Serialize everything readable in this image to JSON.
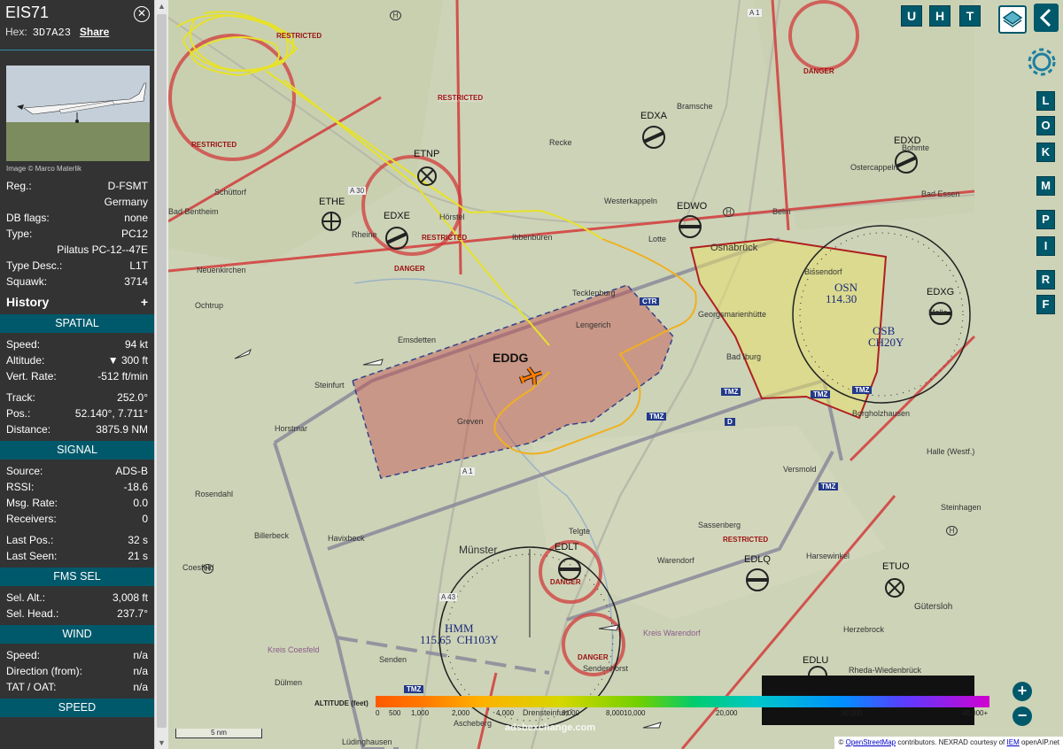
{
  "aircraft": {
    "callsign": "EIS71",
    "hex_label": "Hex:",
    "hex": "3D7A23",
    "share": "Share",
    "photo_credit": "Image © Marco Materlik"
  },
  "info_rows": [
    {
      "key": "Reg.:",
      "value": "D-FSMT"
    },
    {
      "key": "",
      "value": "Germany"
    },
    {
      "key": "DB flags:",
      "value": "none"
    },
    {
      "key": "Type:",
      "value": "PC12"
    },
    {
      "key": "",
      "value": "Pilatus PC-12--47E"
    },
    {
      "key": "Type Desc.:",
      "value": "L1T"
    },
    {
      "key": "Squawk:",
      "value": "3714"
    }
  ],
  "history_label": "History",
  "history_plus": "+",
  "sections": {
    "spatial": "SPATIAL",
    "signal": "SIGNAL",
    "fms": "FMS SEL",
    "wind": "WIND",
    "speed": "SPEED"
  },
  "spatial_rows": [
    {
      "key": "Speed:",
      "value": "94 kt"
    },
    {
      "key": "Altitude:",
      "value": "▼ 300 ft"
    },
    {
      "key": "Vert. Rate:",
      "value": "-512 ft/min"
    },
    {
      "key": "Track:",
      "value": "252.0°"
    },
    {
      "key": "Pos.:",
      "value": "52.140°, 7.711°"
    },
    {
      "key": "Distance:",
      "value": "3875.9 NM"
    }
  ],
  "signal_rows": [
    {
      "key": "Source:",
      "value": "ADS-B"
    },
    {
      "key": "RSSI:",
      "value": "-18.6"
    },
    {
      "key": "Msg. Rate:",
      "value": "0.0"
    },
    {
      "key": "Receivers:",
      "value": "0"
    },
    {
      "key": "Last Pos.:",
      "value": "32 s"
    },
    {
      "key": "Last Seen:",
      "value": "21 s"
    }
  ],
  "fms_rows": [
    {
      "key": "Sel. Alt.:",
      "value": "3,008 ft"
    },
    {
      "key": "Sel. Head.:",
      "value": "237.7°"
    }
  ],
  "wind_rows": [
    {
      "key": "Speed:",
      "value": "n/a"
    },
    {
      "key": "Direction (from):",
      "value": "n/a"
    },
    {
      "key": "TAT / OAT:",
      "value": "n/a"
    }
  ],
  "top_buttons": [
    "U",
    "H",
    "T"
  ],
  "side_buttons": [
    "L",
    "O",
    "K",
    "M",
    "P",
    "I",
    "R",
    "F"
  ],
  "map": {
    "labels": {
      "restricted": "RESTRICTED",
      "danger": "DANGER",
      "ctr": "CTR",
      "tmz": "TMZ",
      "d": "D",
      "eddg": "EDDG",
      "etnp": "ETNP",
      "ethe": "ETHE",
      "edxe": "EDXE",
      "edxa": "EDXA",
      "edwo": "EDWO",
      "edxd": "EDXD",
      "edxg": "EDXG",
      "edlt": "EDLT",
      "edlq": "EDLQ",
      "etuo": "ETUO",
      "edlu": "EDLU",
      "osn": "OSN",
      "osn_freq": "114.30",
      "osb": "OSB",
      "osb_ch": "CH20Y",
      "hmm": "HMM",
      "hmm_freq": "115.65  CH103Y",
      "a1": "A 1",
      "a30": "A 30",
      "a43": "A 43",
      "h": "H"
    },
    "towns": [
      "Schüttorf",
      "Bad Bentheim",
      "Rheine",
      "Neuenkirchen",
      "Ochtrup",
      "Emsdetten",
      "Steinfurt",
      "Horstmar",
      "Greven",
      "Rosendahl",
      "Billerbeck",
      "Havixbeck",
      "Coesfeld",
      "Senden",
      "Dülmen",
      "Lüdinghausen",
      "Münster",
      "Telgte",
      "Warendorf",
      "Sassenberg",
      "Versmold",
      "Borgholzhausen",
      "Halle (Westf.)",
      "Steinhagen",
      "Harsewinkel",
      "Gütersloh",
      "Herzebrock",
      "Rheda-Wiedenbrück",
      "Sendenhorst",
      "Drensteinfurt",
      "Ascheberg",
      "Ibbenbüren",
      "Hörstel",
      "Recke",
      "Westerkappeln",
      "Lotte",
      "Osnabrück",
      "Belm",
      "Bramsche",
      "Ostercappeln",
      "Bad Essen",
      "Bohmte",
      "Melle",
      "Tecklenburg",
      "Lengerich",
      "Georgsmarienhütte",
      "Bad Iburg",
      "Bissendorf",
      "Kreis Coesfeld",
      "Kreis Warendorf"
    ],
    "scale": "5 nm",
    "watermark": "adsbexchange.com"
  },
  "altitude_legend": {
    "label": "ALTITUDE (feet)",
    "ticks": [
      "0",
      "500",
      "1,000",
      "2,000",
      "4,000",
      "6,000",
      "8,000",
      "10,000",
      "20,000",
      "30,000",
      "40,000+"
    ]
  },
  "zoom": {
    "in": "+",
    "out": "−"
  },
  "attribution": {
    "prefix": "©",
    "osm": "OpenStreetMap",
    "mid": "contributors. NEXRAD courtesy of",
    "iem": "IEM",
    "suffix": "openAIP.net"
  },
  "colors": {
    "accent": "#00596b",
    "restricted": "#cc2222",
    "track": "#f0c020"
  }
}
